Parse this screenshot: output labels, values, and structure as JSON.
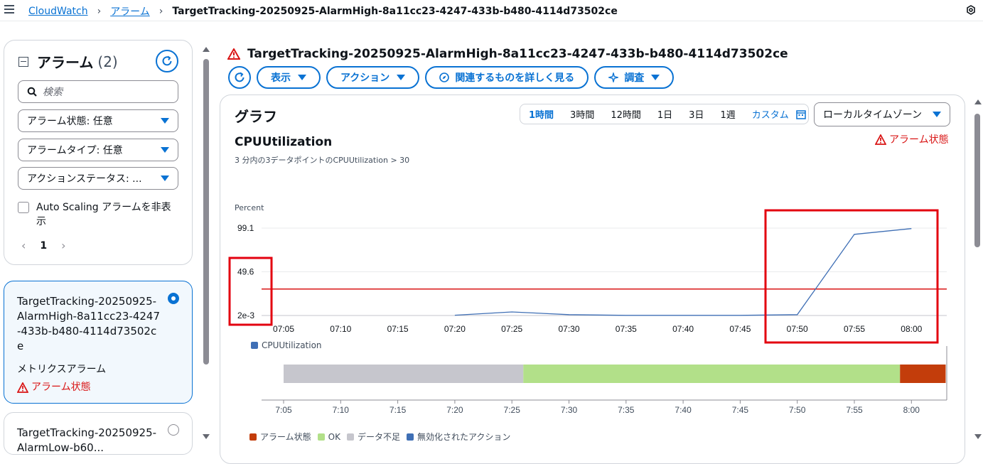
{
  "breadcrumb": {
    "root": "CloudWatch",
    "section": "アラーム",
    "current": "TargetTracking-20250925-AlarmHigh-8a11cc23-4247-433b-b480-4114d73502ce"
  },
  "left_panel": {
    "title": "アラーム",
    "count": "(2)",
    "search_placeholder": "検索",
    "filters": [
      "アラーム状態: 任意",
      "アラームタイプ: 任意",
      "アクションステータス: ..."
    ],
    "hide_autoscaling_label": "Auto Scaling アラームを非表示",
    "page": "1",
    "alarms": [
      {
        "name": "TargetTracking-20250925-AlarmHigh-8a11cc23-4247-433b-b480-4114d73502ce",
        "type": "メトリクスアラーム",
        "state": "アラーム状態",
        "selected": true
      },
      {
        "name": "TargetTracking-20250925-AlarmLow-b60...",
        "selected": false
      }
    ]
  },
  "header": {
    "title": "TargetTracking-20250925-AlarmHigh-8a11cc23-4247-433b-b480-4114d73502ce",
    "buttons": {
      "view": "表示",
      "actions": "アクション",
      "explore": "関連するものを詳しく見る",
      "investigate": "調査"
    }
  },
  "graph": {
    "section_title": "グラフ",
    "ranges": [
      "1時間",
      "3時間",
      "12時間",
      "1日",
      "3日",
      "1週"
    ],
    "custom": "カスタム",
    "active_range": "1時間",
    "timezone": "ローカルタイムゾーン",
    "metric": "CPUUtilization",
    "condition": "3 分内の3データポイントのCPUUtilization > 30",
    "alarm_state_label": "アラーム状態",
    "ylabel": "Percent"
  },
  "chart_data": {
    "type": "line",
    "x": [
      "07:05",
      "07:10",
      "07:15",
      "07:20",
      "07:25",
      "07:30",
      "07:35",
      "07:40",
      "07:45",
      "07:50",
      "07:55",
      "08:00"
    ],
    "y_ticks": [
      "99.1",
      "49.6",
      "2e-3"
    ],
    "ylim": [
      0.002,
      99.1
    ],
    "series": [
      {
        "name": "CPUUtilization",
        "color": "#3f6fb5",
        "points": [
          [
            "07:20",
            0.3
          ],
          [
            "07:25",
            4.0
          ],
          [
            "07:30",
            1.0
          ],
          [
            "07:35",
            0.2
          ],
          [
            "07:40",
            0.2
          ],
          [
            "07:45",
            0.2
          ],
          [
            "07:50",
            1.0
          ],
          [
            "07:55",
            92.0
          ],
          [
            "08:00",
            98.5
          ]
        ]
      }
    ],
    "threshold": 30,
    "threshold_color": "#d91515",
    "state_timeline": {
      "ticks": [
        "7:05",
        "7:10",
        "7:15",
        "7:20",
        "7:25",
        "7:30",
        "7:35",
        "7:40",
        "7:45",
        "7:50",
        "7:55",
        "8:00"
      ],
      "segments": [
        {
          "state": "データ不足",
          "from": "07:05",
          "to": "07:26",
          "color": "#c6c6cd"
        },
        {
          "state": "OK",
          "from": "07:26",
          "to": "07:59",
          "color": "#b2e089"
        },
        {
          "state": "アラーム状態",
          "from": "07:59",
          "to": "08:03",
          "color": "#c33d0b"
        }
      ]
    },
    "legend": [
      {
        "label": "アラーム状態",
        "color": "#c33d0b"
      },
      {
        "label": "OK",
        "color": "#b2e089"
      },
      {
        "label": "データ不足",
        "color": "#c6c6cd"
      },
      {
        "label": "無効化されたアクション",
        "color": "#3f6fb5"
      }
    ]
  },
  "colors": {
    "accent": "#0972d3",
    "alarm": "#d91515"
  }
}
